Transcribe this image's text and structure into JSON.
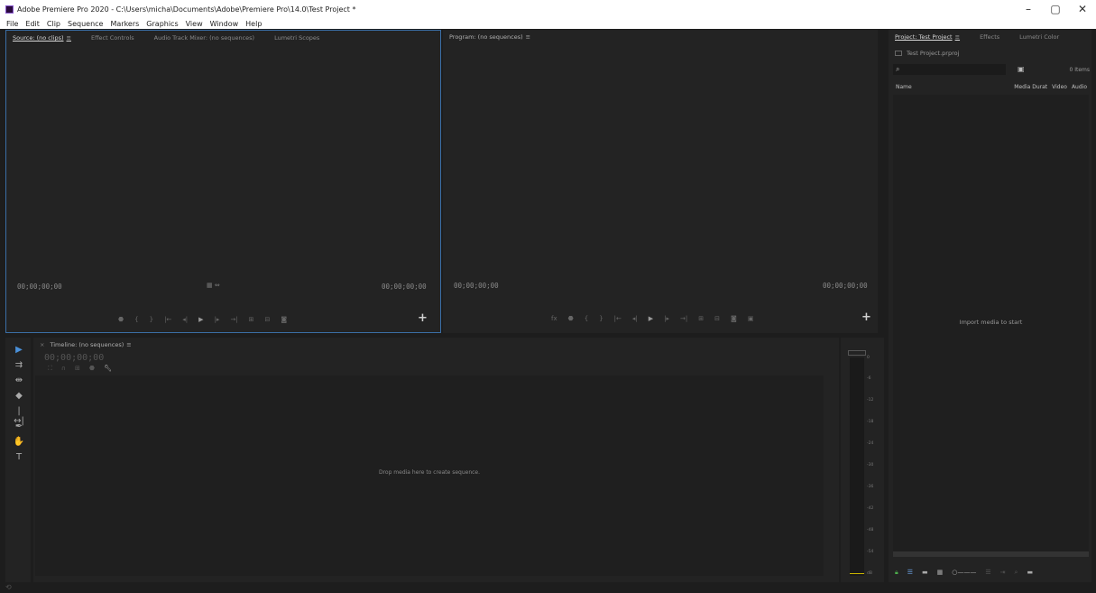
{
  "window": {
    "title": "Adobe Premiere Pro 2020 - C:\\Users\\micha\\Documents\\Adobe\\Premiere Pro\\14.0\\Test Project *",
    "controls": [
      "–",
      "▢",
      "✕"
    ]
  },
  "menu": [
    "File",
    "Edit",
    "Clip",
    "Sequence",
    "Markers",
    "Graphics",
    "View",
    "Window",
    "Help"
  ],
  "source_panel": {
    "tabs": [
      "Source: (no clips)",
      "Effect Controls",
      "Audio Track Mixer: (no sequences)",
      "Lumetri Scopes"
    ],
    "timecode_left": "00;00;00;00",
    "timecode_right": "00;00;00;00",
    "plus": "+"
  },
  "program_panel": {
    "tab": "Program: (no sequences)",
    "timecode_left": "00;00;00;00",
    "timecode_right": "00;00;00;00",
    "plus": "+"
  },
  "project_panel": {
    "tabs": [
      "Project: Test Project",
      "Effects",
      "Lumetri Color"
    ],
    "file_name": "Test Project.prproj",
    "item_count": "0 Items",
    "columns": [
      "Name",
      "Media Durat",
      "Video",
      "Audio"
    ],
    "empty_message": "Import media to start"
  },
  "timeline_panel": {
    "tab": "Timeline: (no sequences)",
    "timecode": "00;00;00;00",
    "drop_message": "Drop media here to create sequence."
  },
  "audio_meter": {
    "scale": [
      "0",
      "-6",
      "-12",
      "-18",
      "-24",
      "-30",
      "-36",
      "-42",
      "-48",
      "-54",
      "dB"
    ]
  },
  "icons": {
    "menu_glyph": "≡",
    "tools": [
      "selection-tool-icon",
      "track-select-tool-icon",
      "ripple-edit-tool-icon",
      "razor-tool-icon",
      "slip-tool-icon",
      "pen-tool-icon",
      "hand-tool-icon",
      "type-tool-icon"
    ]
  }
}
